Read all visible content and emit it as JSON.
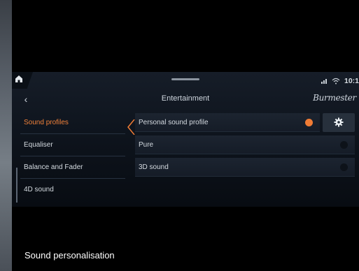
{
  "status_bar": {
    "home_icon": "home-icon",
    "icons": [
      "signal-icon",
      "wifi-icon"
    ],
    "time": "10:1"
  },
  "header": {
    "back_icon": "chevron-left-icon",
    "back_label": "‹",
    "title": "Entertainment",
    "brand": "Burmester"
  },
  "sidebar": {
    "items": [
      {
        "label": "Sound profiles",
        "active": true
      },
      {
        "label": "Equaliser",
        "active": false
      },
      {
        "label": "Balance and Fader",
        "active": false
      },
      {
        "label": "4D sound",
        "active": false
      }
    ]
  },
  "profiles": {
    "items": [
      {
        "label": "Personal sound profile",
        "selected": true
      },
      {
        "label": "Pure",
        "selected": false
      },
      {
        "label": "3D sound",
        "selected": false
      }
    ],
    "settings_icon": "gear-icon"
  },
  "colors": {
    "accent": "#f07c35",
    "text": "#d4dae0",
    "background": "#0e141d"
  },
  "caption": "Sound personalisation"
}
